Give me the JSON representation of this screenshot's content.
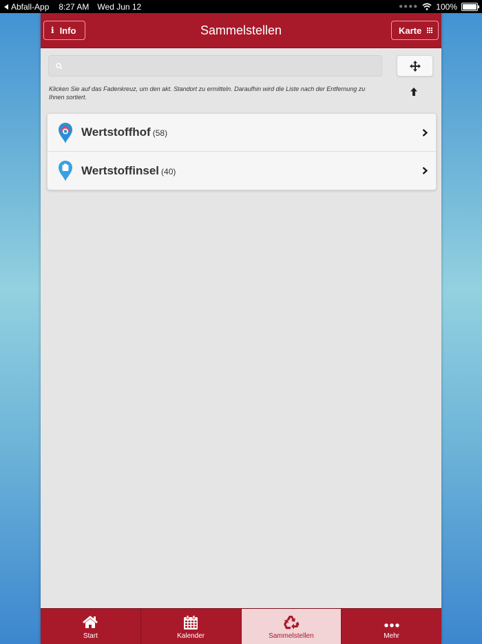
{
  "status_bar": {
    "back_app": "Abfall-App",
    "time": "8:27 AM",
    "date": "Wed Jun 12",
    "battery": "100%"
  },
  "header": {
    "title": "Sammelstellen",
    "info_label": "Info",
    "karte_label": "Karte"
  },
  "search": {
    "placeholder": "",
    "value": ""
  },
  "hint_text": "Klicken Sie auf das Fadenkreuz, um den akt. Standort zu ermitteln. Daraufhin wird die Liste nach der Entfernung zu Ihnen sortiert.",
  "list": [
    {
      "name": "Wertstoffhof",
      "count": "(58)",
      "icon": "wertstoffhof-pin-icon"
    },
    {
      "name": "Wertstoffinsel",
      "count": "(40)",
      "icon": "wertstoffinsel-pin-icon"
    }
  ],
  "tabs": [
    {
      "label": "Start",
      "icon": "home-icon"
    },
    {
      "label": "Kalender",
      "icon": "calendar-icon"
    },
    {
      "label": "Sammelstellen",
      "icon": "recycle-icon",
      "active": true
    },
    {
      "label": "Mehr",
      "icon": "more-dots-icon"
    }
  ],
  "colors": {
    "brand": "#a8192a",
    "active_tab_bg": "#f2d3d6",
    "content_bg": "#e5e5e5"
  }
}
